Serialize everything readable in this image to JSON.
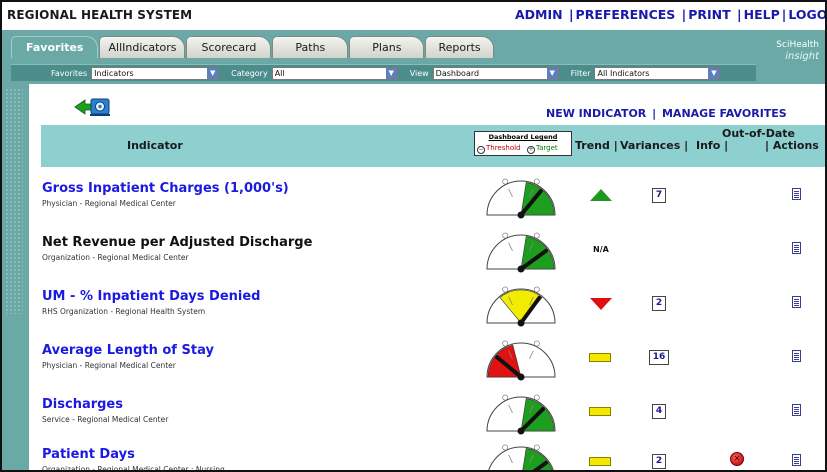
{
  "header": {
    "system_title": "REGIONAL HEALTH SYSTEM",
    "links": [
      {
        "label": "ADMIN"
      },
      {
        "label": "PREFERENCES"
      },
      {
        "label": "PRINT"
      },
      {
        "label": "HELP"
      },
      {
        "label": "LOGOUT"
      }
    ]
  },
  "tabs": [
    {
      "label": "Favorites",
      "active": true
    },
    {
      "label": "AllIndicators",
      "active": false
    },
    {
      "label": "Scorecard",
      "active": false
    },
    {
      "label": "Paths",
      "active": false
    },
    {
      "label": "Plans",
      "active": false
    },
    {
      "label": "Reports",
      "active": false
    }
  ],
  "logo": {
    "line1": "SciHealth",
    "line2": "insight"
  },
  "filters": {
    "favorites": {
      "label": "Favorites",
      "value": "Indicators"
    },
    "category": {
      "label": "Category",
      "value": "All"
    },
    "view": {
      "label": "View",
      "value": "Dashboard"
    },
    "filter": {
      "label": "Filter",
      "value": "All Indicators"
    }
  },
  "management_links": {
    "new_indicator": "NEW INDICATOR",
    "separator": "|",
    "manage_favorites": "MANAGE FAVORITES"
  },
  "table_header": {
    "indicator": "Indicator",
    "legend_title": "Dashboard Legend",
    "legend_threshold": "Threshold",
    "legend_target": "Target",
    "trend": "Trend |",
    "variances": "Variances |",
    "info": "Info |",
    "out_of_date": "Out-of-Date",
    "actions": "| Actions"
  },
  "rows": [
    {
      "name": "Gross Inpatient Charges (1,000's)",
      "sub": "Physician - Regional Medical Center",
      "linked": true,
      "gauge_zone": "green",
      "needle_fraction": 0.72,
      "trend": "up",
      "variances": "7",
      "out_of_date": false
    },
    {
      "name": "Net Revenue per Adjusted Discharge",
      "sub": "Organization - Regional Medical Center",
      "linked": false,
      "gauge_zone": "green",
      "needle_fraction": 0.8,
      "trend": "na",
      "trend_text": "N/A",
      "variances": "",
      "out_of_date": false
    },
    {
      "name": "UM - % Inpatient Days Denied",
      "sub": "RHS Organization - Regional Health System",
      "linked": true,
      "gauge_zone": "yellow",
      "needle_fraction": 0.7,
      "trend": "down",
      "variances": "2",
      "out_of_date": false
    },
    {
      "name": "Average Length of Stay",
      "sub": "Physician - Regional Medical Center",
      "linked": true,
      "gauge_zone": "red",
      "needle_fraction": 0.22,
      "trend": "flat",
      "variances": "16",
      "out_of_date": false
    },
    {
      "name": "Discharges",
      "sub": "Service - Regional Medical Center",
      "linked": true,
      "gauge_zone": "green",
      "needle_fraction": 0.75,
      "trend": "flat",
      "variances": "4",
      "out_of_date": false
    },
    {
      "name": "Patient Days",
      "sub": "Organization - Regional Medical Center : Nursing",
      "linked": true,
      "gauge_zone": "green",
      "needle_fraction": 0.8,
      "trend": "flat",
      "variances": "2",
      "out_of_date": true
    }
  ],
  "colors": {
    "teal": "#6aa9a6",
    "header_teal": "#8ecfcf",
    "link_blue": "#1a1ae0",
    "gauge_green": "#1e9e1e",
    "gauge_yellow": "#f2ec00",
    "gauge_red": "#e01212",
    "trend_yellow": "#f5e800"
  }
}
